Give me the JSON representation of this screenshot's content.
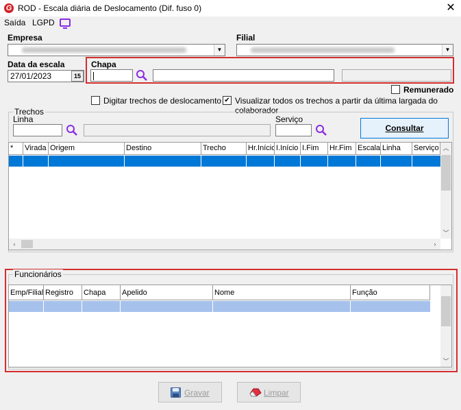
{
  "window": {
    "app_icon": "G",
    "title": "ROD - Escala diária de Deslocamento (Dif. fuso 0)",
    "close": "✕"
  },
  "menu": {
    "saida": "Saída",
    "lgpd": "LGPD"
  },
  "empresa": {
    "label": "Empresa"
  },
  "filial": {
    "label": "Filial"
  },
  "data_escala": {
    "label": "Data da escala",
    "value": "27/01/2023",
    "cal_label": "15"
  },
  "chapa": {
    "label": "Chapa",
    "value": ""
  },
  "remunerado": {
    "label": "Remunerado",
    "checked": false
  },
  "digitar_trechos": {
    "label": "Digitar trechos de deslocamento",
    "checked": false
  },
  "visualizar_todos": {
    "label": "Visualizar todos os trechos a partir da última largada do colaborador",
    "checked": true
  },
  "trechos": {
    "title": "Trechos",
    "linha_label": "Linha",
    "servico_label": "Serviço",
    "consultar": "Consultar",
    "columns": [
      "*",
      "Virada",
      "Origem",
      "Destino",
      "Trecho",
      "Hr.Início",
      "I.Início",
      "I.Fim",
      "Hr.Fim",
      "Escala",
      "Linha",
      "Serviço"
    ]
  },
  "funcionarios": {
    "title": "Funcionários",
    "columns": [
      "Emp/Filial",
      "Registro",
      "Chapa",
      "Apelido",
      "Nome",
      "Função"
    ]
  },
  "buttons": {
    "gravar": "Gravar",
    "limpar": "Limpar"
  },
  "colors": {
    "selection_blue": "#0078d7",
    "selection_light": "#a6c2ec",
    "highlight_red": "#d42d2d",
    "icon_purple": "#8a2be2"
  }
}
